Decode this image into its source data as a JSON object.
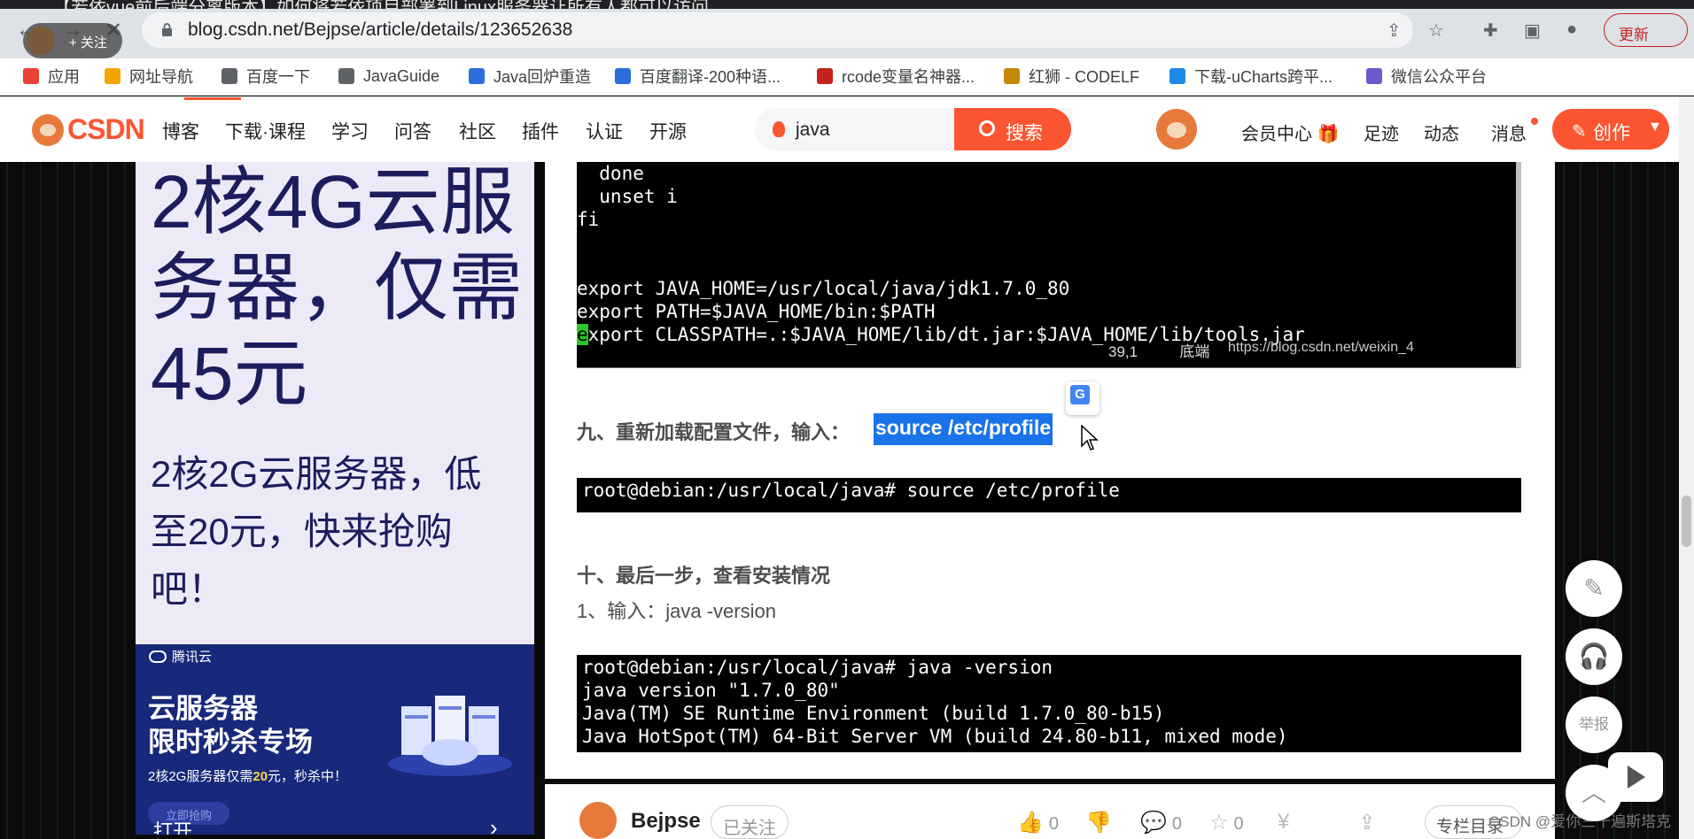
{
  "browser": {
    "tab_title": "【若依vue前后端分离版本】如何将若依项目部署到Linux服务器让所有人都可以访问",
    "url": "blog.csdn.net/Bejpse/article/details/123652638",
    "follow_pill": "+ 关注",
    "update_button": "更新"
  },
  "bookmarks": [
    {
      "label": "应用",
      "color": "#e94235"
    },
    {
      "label": "网址导航",
      "color": "#f4a300"
    },
    {
      "label": "百度一下",
      "color": "#5f6368"
    },
    {
      "label": "JavaGuide",
      "color": "#5f6368"
    },
    {
      "label": "Java回炉重造",
      "color": "#2a6edb"
    },
    {
      "label": "百度翻译-200种语...",
      "color": "#2a6edb"
    },
    {
      "label": "rcode变量名神器...",
      "color": "#c5221f"
    },
    {
      "label": "红狮 - CODELF",
      "color": "#c28a00"
    },
    {
      "label": "下载-uCharts跨平...",
      "color": "#1e88e5"
    },
    {
      "label": "微信公众平台",
      "color": "#6a5acd"
    }
  ],
  "csdn": {
    "logo": "CSDN",
    "nav": [
      "博客",
      "下载·课程",
      "学习",
      "问答",
      "社区",
      "插件",
      "认证",
      "开源"
    ],
    "search_value": "java",
    "search_button": "搜索",
    "right_nav": [
      "会员中心 🎁",
      "足迹",
      "动态",
      "消息"
    ],
    "create_button": "创作"
  },
  "ad": {
    "headline": "2核4G云服务器，仅需45元",
    "subline": "2核2G云服务器，低至20元，快来抢购吧！",
    "brand": "腾讯云",
    "title_line1": "云服务器",
    "title_line2": "限时秒杀专场",
    "promo_prefix": "2核2G服务器仅需",
    "promo_price": "20",
    "promo_suffix": "元，秒杀中！",
    "ghost_button": "立即抢购",
    "open_button": "打开"
  },
  "article": {
    "terminal1_lines": [
      "  done",
      "  unset i",
      "fi",
      "",
      "",
      "export JAVA_HOME=/usr/local/java/jdk1.7.0_80",
      "export PATH=$JAVA_HOME/bin:$PATH",
      "xport CLASSPATH=.:$JAVA_HOME/lib/dt.jar:$JAVA_HOME/lib/tools.jar"
    ],
    "terminal1_cursor_char": "e",
    "terminal1_status": "39,1          底端",
    "terminal1_watermark": "https://blog.csdn.net/weixin_4",
    "step9_heading": "九、重新加载配置文件，输入：",
    "step9_selected": "source /etc/profile",
    "terminal2_line": "root@debian:/usr/local/java# source /etc/profile",
    "step10_heading": "十、最后一步，查看安装情况",
    "step10_text": "1、输入：java -version",
    "terminal3_lines": [
      "root@debian:/usr/local/java# java -version",
      "java version \"1.7.0_80\"",
      "Java(TM) SE Runtime Environment (build 1.7.0_80-b15)",
      "Java HotSpot(TM) 64-Bit Server VM (build 24.80-b11, mixed mode)"
    ]
  },
  "bottom_bar": {
    "author": "Bejpse",
    "followed": "已关注",
    "like_count": "0",
    "comment_count": "0",
    "star_count": "0",
    "column_button": "专栏目录",
    "watermark": "CSDN @爱你三千遍斯塔克"
  },
  "float_buttons": {
    "report": "举报"
  }
}
